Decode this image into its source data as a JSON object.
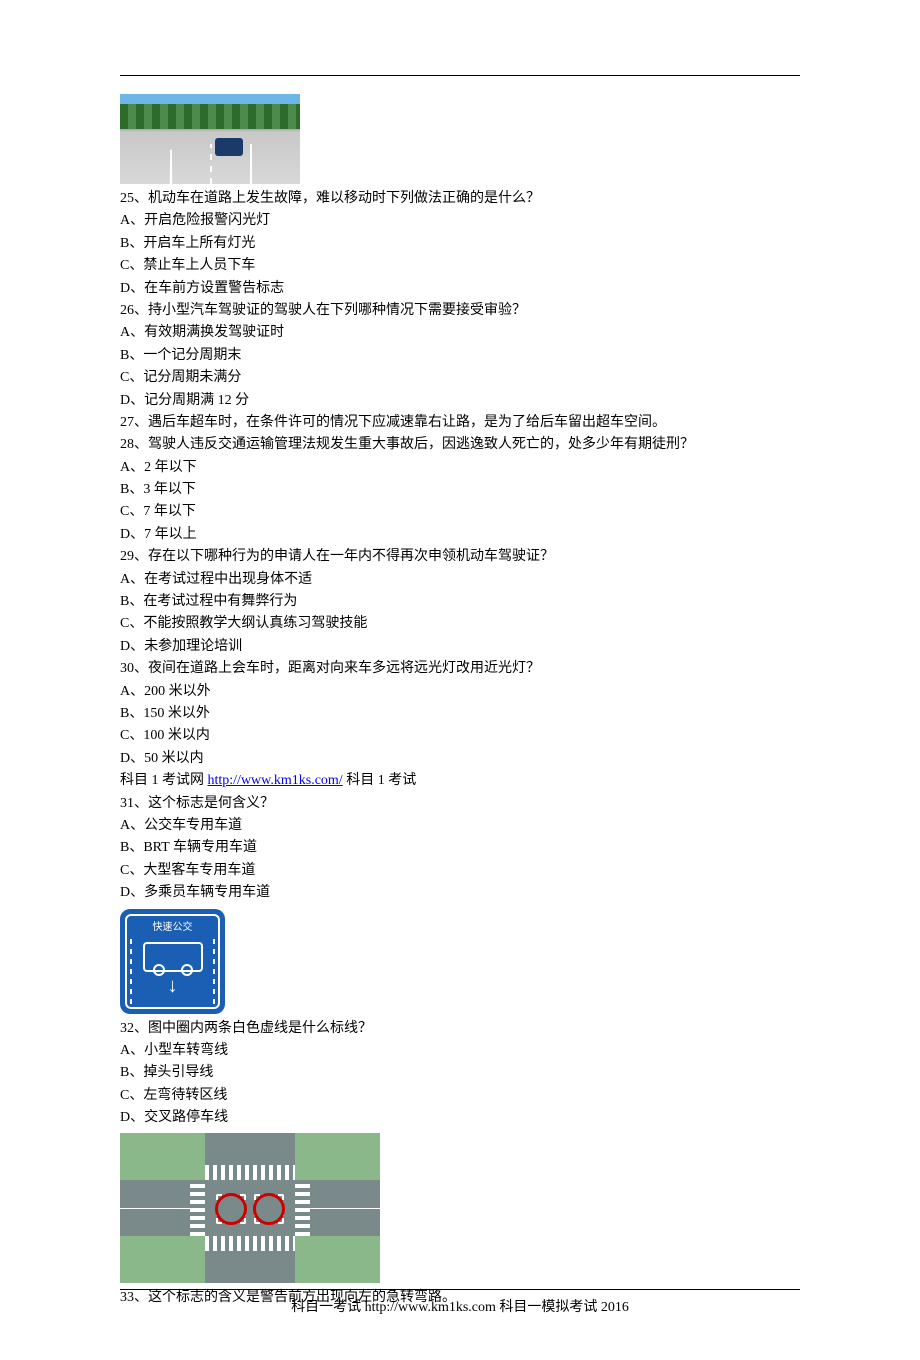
{
  "questions": [
    {
      "number": "25",
      "text": "机动车在道路上发生故障，难以移动时下列做法正确的是什么？",
      "options": [
        "A、开启危险报警闪光灯",
        "B、开启车上所有灯光",
        "C、禁止车上人员下车",
        "D、在车前方设置警告标志"
      ]
    },
    {
      "number": "26",
      "text": "持小型汽车驾驶证的驾驶人在下列哪种情况下需要接受审验？",
      "options": [
        "A、有效期满换发驾驶证时",
        "B、一个记分周期末",
        "C、记分周期未满分",
        "D、记分周期满 12 分"
      ]
    },
    {
      "number": "27",
      "text": "遇后车超车时，在条件许可的情况下应减速靠右让路，是为了给后车留出超车空间。"
    },
    {
      "number": "28",
      "text": "驾驶人违反交通运输管理法规发生重大事故后，因逃逸致人死亡的，处多少年有期徒刑？",
      "options": [
        "A、2 年以下",
        "B、3 年以下",
        "C、7 年以下",
        "D、7 年以上"
      ]
    },
    {
      "number": "29",
      "text": "存在以下哪种行为的申请人在一年内不得再次申领机动车驾驶证？",
      "options": [
        "A、在考试过程中出现身体不适",
        "B、在考试过程中有舞弊行为",
        "C、不能按照教学大纲认真练习驾驶技能",
        "D、未参加理论培训"
      ]
    },
    {
      "number": "30",
      "text": "夜间在道路上会车时，距离对向来车多远将远光灯改用近光灯？",
      "options": [
        "A、200 米以外",
        "B、150 米以外",
        "C、100 米以内",
        "D、50 米以内"
      ]
    }
  ],
  "link_line": {
    "prefix": "科目 1 考试网 ",
    "url": "http://www.km1ks.com/",
    "suffix": " 科目 1 考试"
  },
  "questions2": [
    {
      "number": "31",
      "text": "这个标志是何含义？",
      "options": [
        "A、公交车专用车道",
        "B、BRT 车辆专用车道",
        "C、大型客车专用车道",
        "D、多乘员车辆专用车道"
      ],
      "sign_label": "快速公交"
    },
    {
      "number": "32",
      "text": "图中圈内两条白色虚线是什么标线？",
      "options": [
        "A、小型车转弯线",
        "B、掉头引导线",
        "C、左弯待转区线",
        "D、交叉路停车线"
      ]
    },
    {
      "number": "33",
      "text": "这个标志的含义是警告前方出现向左的急转弯路。"
    }
  ],
  "footer": "科目一考试 http://www.km1ks.com 科目一模拟考试 2016"
}
